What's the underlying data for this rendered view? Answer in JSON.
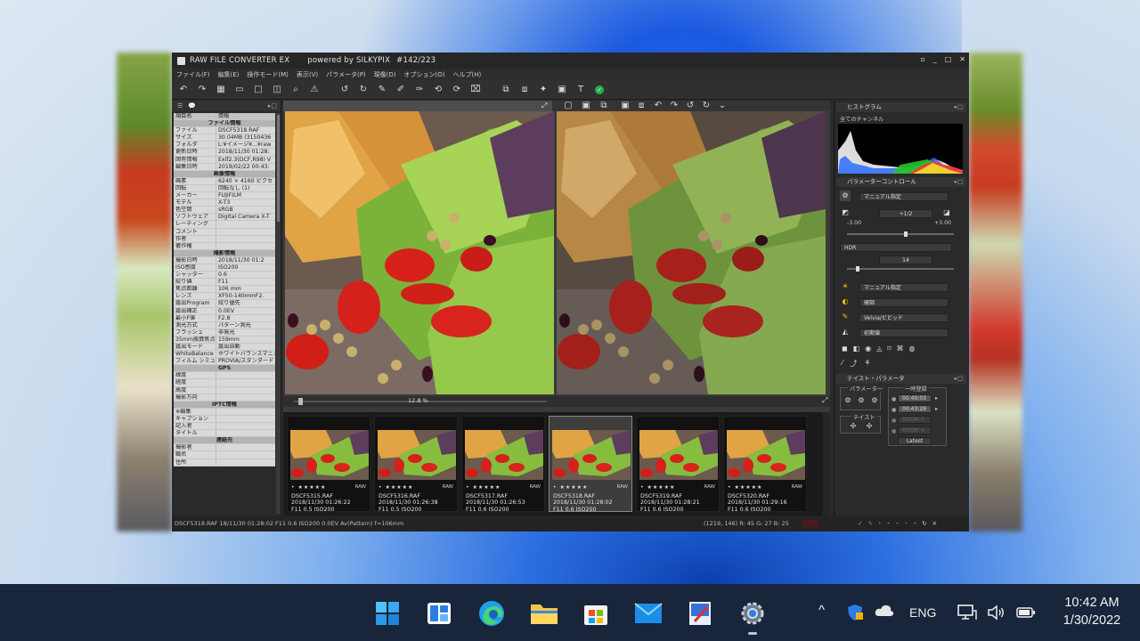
{
  "window": {
    "title": "RAW FILE CONVERTER EX",
    "subtitle": "powered by SILKYPIX",
    "counter": "#142/223",
    "controls": [
      "▫",
      "_",
      "□",
      "✕"
    ]
  },
  "menu": [
    "ファイル(F)",
    "編集(E)",
    "操作モード(M)",
    "表示(V)",
    "パラメータ(P)",
    "現像(D)",
    "オプション(O)",
    "ヘルプ(H)"
  ],
  "left_panel": {
    "tabs": [
      "☰",
      "💬"
    ],
    "columns": {
      "k": "項目名",
      "v": "情報"
    },
    "rows": [
      {
        "sec": "ファイル情報"
      },
      {
        "k": "ファイル",
        "v": "DSCF5318.RAF"
      },
      {
        "k": "サイズ",
        "v": "30.04MB (3150436"
      },
      {
        "k": "フォルダ",
        "v": "L:¥イメージ¥...¥raw"
      },
      {
        "k": "更新日時",
        "v": "2018/11/30 01:28:"
      },
      {
        "k": "固有情報",
        "v": "Exif2.3(DCF,R98) V"
      },
      {
        "k": "編集日時",
        "v": "2019/02/22 00:43:"
      },
      {
        "sec": "画像情報"
      },
      {
        "k": "画素",
        "v": "6240 × 4160 ピクセ"
      },
      {
        "k": "回転",
        "v": "回転なし (1)"
      },
      {
        "k": "メーカー",
        "v": "FUJIFILM"
      },
      {
        "k": "モデル",
        "v": "X-T3"
      },
      {
        "k": "色空間",
        "v": "sRGB"
      },
      {
        "k": "ソフトウェア",
        "v": "Digital Camera X-T"
      },
      {
        "k": "レーティング",
        "v": ""
      },
      {
        "k": "コメント",
        "v": ""
      },
      {
        "k": "作者",
        "v": ""
      },
      {
        "k": "著作権",
        "v": ""
      },
      {
        "sec": "撮影情報"
      },
      {
        "k": "撮影日時",
        "v": "2018/11/30 01:2"
      },
      {
        "k": "ISO感度",
        "v": "ISO200"
      },
      {
        "k": "シャッター",
        "v": "0.6"
      },
      {
        "k": "絞り値",
        "v": "F11"
      },
      {
        "k": "焦点距離",
        "v": "106 mm"
      },
      {
        "k": "レンズ",
        "v": "XF50-140mmF2."
      },
      {
        "k": "露出Program",
        "v": "絞り優先"
      },
      {
        "k": "露出補正",
        "v": "0.0EV"
      },
      {
        "k": "最小F値",
        "v": "F2.8"
      },
      {
        "k": "測光方式",
        "v": "パターン測光"
      },
      {
        "k": "フラッシュ",
        "v": "非発光"
      },
      {
        "k": "35mm換算焦点",
        "v": "159mm"
      },
      {
        "k": "露出モード",
        "v": "露出自動"
      },
      {
        "k": "WhiteBalance",
        "v": "ホワイトバランスマニュア"
      },
      {
        "k": "フィルム シミュレ",
        "v": "PROVIA/スタンダード"
      },
      {
        "sec": "GPS"
      },
      {
        "k": "緯度",
        "v": ""
      },
      {
        "k": "経度",
        "v": ""
      },
      {
        "k": "高度",
        "v": ""
      },
      {
        "k": "撮影方向",
        "v": ""
      },
      {
        "sec": "IPTC情報"
      },
      {
        "k": "※編集",
        "v": ""
      },
      {
        "k": "キャプション",
        "v": ""
      },
      {
        "k": "記入者",
        "v": ""
      },
      {
        "k": "タイトル",
        "v": ""
      },
      {
        "sec": "連絡先"
      },
      {
        "k": "撮影者",
        "v": ""
      },
      {
        "k": "職名",
        "v": ""
      },
      {
        "k": "住所",
        "v": ""
      }
    ]
  },
  "preview": {
    "zoom_label": "12.8 %"
  },
  "thumbnails": [
    {
      "name": "DSCF5315.RAF",
      "date": "2018/11/30 01:26:22",
      "exif": "F11 0.5 ISO200",
      "selected": false
    },
    {
      "name": "DSCF5316.RAF",
      "date": "2018/11/30 01:26:38",
      "exif": "F11 0.5 ISO200",
      "selected": false
    },
    {
      "name": "DSCF5317.RAF",
      "date": "2018/11/30 01:26:53",
      "exif": "F11 0.6 ISO200",
      "selected": false
    },
    {
      "name": "DSCF5318.RAF",
      "date": "2018/11/30 01:28:02",
      "exif": "F11 0.6 ISO200",
      "selected": true
    },
    {
      "name": "DSCF5319.RAF",
      "date": "2018/11/30 01:28:21",
      "exif": "F11 0.6 ISO200",
      "selected": false
    },
    {
      "name": "DSCF5320.RAF",
      "date": "2018/11/30 01:29:16",
      "exif": "F11 0.6 ISO200",
      "selected": false
    }
  ],
  "thumb_stars": "• ★★★★★",
  "thumb_raw": "RAW",
  "right_panel": {
    "histogram_title": "ヒストグラム",
    "histogram_channel": "全てのチャンネル",
    "param_title": "パラメーターコントロール",
    "wb_mode": "マニュアル指定",
    "exposure_value": "+1/2",
    "exposure_min": "-3.00",
    "exposure_max": "+3.00",
    "hdr_label": "HDR",
    "hdr_value": "14",
    "tone_mode": "マニュアル指定",
    "contrast_mode": "硬調",
    "color_mode": "Velvia/ビビッド",
    "sharp_mode": "初期値",
    "taste_title": "テイスト・パラメータ",
    "taste_param_label": "パラメーター",
    "taste_label": "テイスト",
    "temp_save_label": "一時登録",
    "temp_slots": [
      "00:40:03",
      "00:43:29",
      "ROOM 3",
      "ROOM 4"
    ],
    "latest_button": "Latest"
  },
  "status": {
    "text": "DSCF5318.RAF 18/11/30 01:28:02 F11 0.6 ISO200  0.0EV Av(Pattern) f=106mm",
    "coords": "(1219, 146) R: 45 G: 27 B: 25"
  },
  "taskbar": {
    "icons": [
      "windows-start",
      "widgets",
      "edge",
      "file-explorer",
      "microsoft-store",
      "mail",
      "paint",
      "settings"
    ],
    "tray_language": "ENG",
    "time": "10:42 AM",
    "date": "1/30/2022"
  }
}
